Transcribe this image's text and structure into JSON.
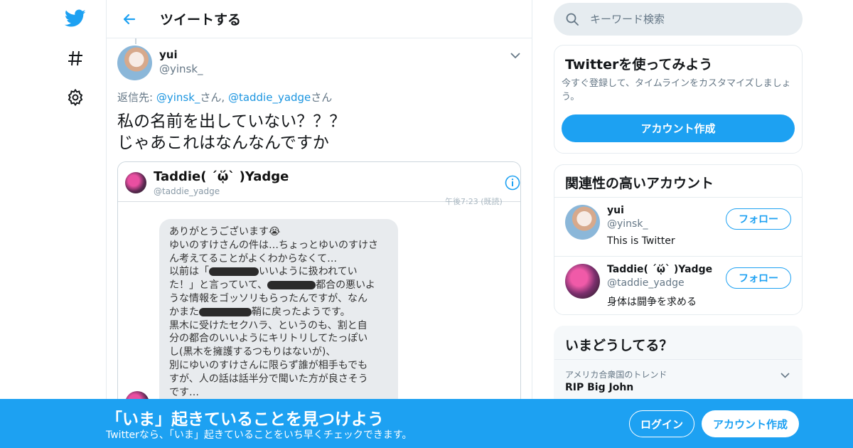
{
  "colors": {
    "accent": "#1da1f2",
    "link": "#1b95e0",
    "muted": "#657786",
    "border": "#e6ecf0"
  },
  "nav": {
    "icons": [
      "twitter-logo-icon",
      "hashtag-icon",
      "gear-icon"
    ]
  },
  "header": {
    "title": "ツイートする",
    "back_icon": "back-arrow-icon"
  },
  "tweet": {
    "name": "yui",
    "handle": "@yinsk_",
    "reply_prefix": "返信先: ",
    "reply_user1": "@yinsk_",
    "reply_sep": "さん, ",
    "reply_user2": "@taddie_yadge",
    "reply_suffix": "さん",
    "text": "私の名前を出していない？？？\nじゃあこれはなんなんですか",
    "media": {
      "name": "Taddie( ˊᾥˋ )Yadge",
      "handle": "@taddie_yadge",
      "cut_text": "午後7:23 (既読)",
      "message_lines": [
        "ありがとうございます😭",
        "ゆいのすけさんの件は…ちょっとゆいのすけさ",
        "ん考えてることがよくわからなくて…",
        "以前は「",
        "いいように扱われてい",
        "た！」と言っていて、",
        "都合の悪いよ",
        "うな情報をゴッソリもらったんですが、なん",
        "かまた",
        "鞘に戻ったようです。",
        "黒木に受けたセクハラ、というのも、割と自",
        "分の都合のいいようにキリトリしてたっぽい",
        "し(黒木を擁護するつもりはないが)、",
        "別にゆいのすけさんに限らず誰が相手もでも",
        "すが、人の話は話半分で聞いた方が良さそう",
        "です…"
      ]
    }
  },
  "search": {
    "placeholder": "キーワード検索"
  },
  "signup": {
    "title": "Twitterを使ってみよう",
    "desc": "今すぐ登録して、タイムラインをカスタマイズしましょう。",
    "button": "アカウント作成"
  },
  "related": {
    "title": "関連性の高いアカウント",
    "accounts": [
      {
        "name": "yui",
        "handle": "@yinsk_",
        "bio": "This is Twitter",
        "follow": "フォロー"
      },
      {
        "name": "Taddie( ˊᾥˋ )Yadge",
        "handle": "@taddie_yadge",
        "bio": "身体は闘争を求める",
        "follow": "フォロー"
      }
    ]
  },
  "trends": {
    "title": "いまどうしてる？",
    "items": [
      {
        "context": "アメリカ合衆国のトレンド",
        "name": "RIP Big John"
      }
    ]
  },
  "banner": {
    "title": "「いま」起きていることを見つけよう",
    "subtitle": "Twitterなら、「いま」起きていることをいち早くチェックできます。",
    "login": "ログイン",
    "signup": "アカウント作成"
  }
}
